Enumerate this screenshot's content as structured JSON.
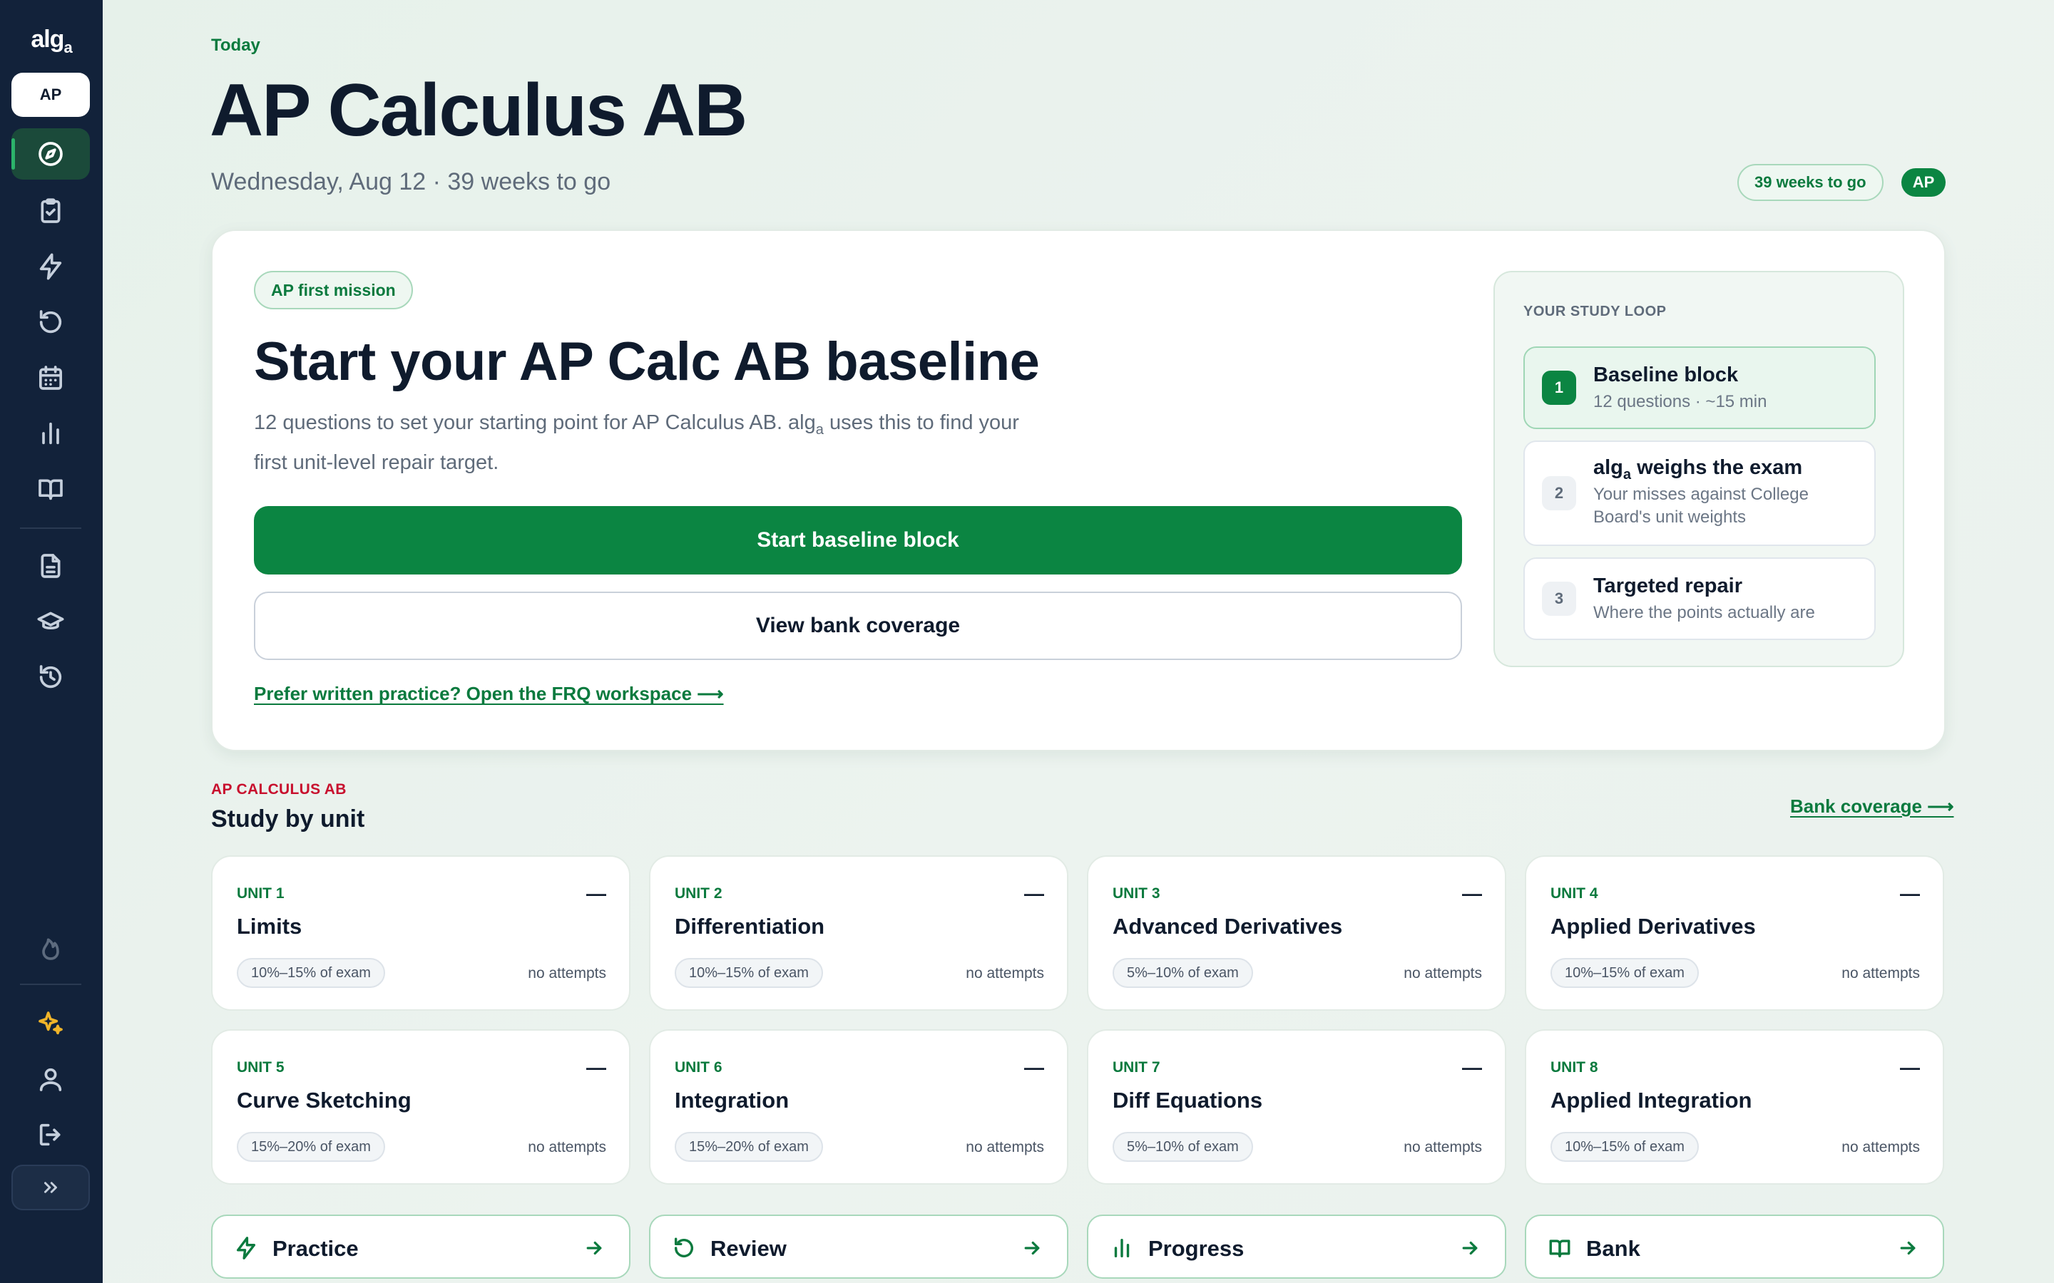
{
  "sidebar": {
    "logo": "alg",
    "logo_sub": "a",
    "exam_chip": "AP",
    "nav": [
      {
        "icon": "compass-icon",
        "active": true
      },
      {
        "icon": "clipboard-check-icon"
      },
      {
        "icon": "lightning-icon"
      },
      {
        "icon": "refresh-icon"
      },
      {
        "icon": "calendar-icon"
      },
      {
        "icon": "bar-chart-icon"
      },
      {
        "icon": "book-open-icon"
      },
      {
        "icon": "document-icon"
      },
      {
        "icon": "graduation-cap-icon"
      },
      {
        "icon": "history-icon"
      },
      {
        "icon": "flame-icon"
      },
      {
        "icon": "sparkles-icon"
      },
      {
        "icon": "user-icon"
      },
      {
        "icon": "logout-icon"
      }
    ],
    "expand_icon": "chevrons-right-icon"
  },
  "header": {
    "kicker": "Today",
    "title": "AP Calculus AB",
    "date_line": "Wednesday, Aug 12 · 39 weeks to go",
    "weeks_badge": "39 weeks to go",
    "exam_badge": "AP"
  },
  "hero": {
    "pill": "AP first mission",
    "title": "Start your AP Calc AB baseline",
    "desc_before": "12 questions to set your starting point for AP Calculus AB. alg",
    "desc_sub": "a",
    "desc_after": " uses this to find your first unit-level repair target.",
    "primary_button": "Start baseline block",
    "secondary_button": "View bank coverage",
    "frq_link": "Prefer written practice? Open the FRQ workspace ⟶",
    "loop": {
      "label": "YOUR STUDY LOOP",
      "steps": [
        {
          "num": "1",
          "title": "Baseline block",
          "sub": "12 questions · ~15 min"
        },
        {
          "num": "2",
          "title_before": "alg",
          "title_sub": "a",
          "title_after": " weighs the exam",
          "sub": "Your misses against College Board's unit weights"
        },
        {
          "num": "3",
          "title": "Targeted repair",
          "sub": "Where the points actually are"
        }
      ]
    }
  },
  "units_section": {
    "kicker": "AP CALCULUS AB",
    "title": "Study by unit",
    "bank_link": "Bank coverage ⟶",
    "units": [
      {
        "label": "UNIT 1",
        "name": "Limits",
        "weight": "10%–15% of exam",
        "attempts": "no attempts",
        "status": "—"
      },
      {
        "label": "UNIT 2",
        "name": "Differentiation",
        "weight": "10%–15% of exam",
        "attempts": "no attempts",
        "status": "—"
      },
      {
        "label": "UNIT 3",
        "name": "Advanced Derivatives",
        "weight": "5%–10% of exam",
        "attempts": "no attempts",
        "status": "—"
      },
      {
        "label": "UNIT 4",
        "name": "Applied Derivatives",
        "weight": "10%–15% of exam",
        "attempts": "no attempts",
        "status": "—"
      },
      {
        "label": "UNIT 5",
        "name": "Curve Sketching",
        "weight": "15%–20% of exam",
        "attempts": "no attempts",
        "status": "—"
      },
      {
        "label": "UNIT 6",
        "name": "Integration",
        "weight": "15%–20% of exam",
        "attempts": "no attempts",
        "status": "—"
      },
      {
        "label": "UNIT 7",
        "name": "Diff Equations",
        "weight": "5%–10% of exam",
        "attempts": "no attempts",
        "status": "—"
      },
      {
        "label": "UNIT 8",
        "name": "Applied Integration",
        "weight": "10%–15% of exam",
        "attempts": "no attempts",
        "status": "—"
      }
    ]
  },
  "quick_links": [
    {
      "label": "Practice",
      "icon": "lightning-icon"
    },
    {
      "label": "Review",
      "icon": "refresh-icon"
    },
    {
      "label": "Progress",
      "icon": "bar-chart-icon"
    },
    {
      "label": "Bank",
      "icon": "book-open-icon"
    }
  ],
  "colors": {
    "brand_green": "#0b8542",
    "sidebar_bg": "#12223a",
    "kicker_red": "#c8102e"
  }
}
